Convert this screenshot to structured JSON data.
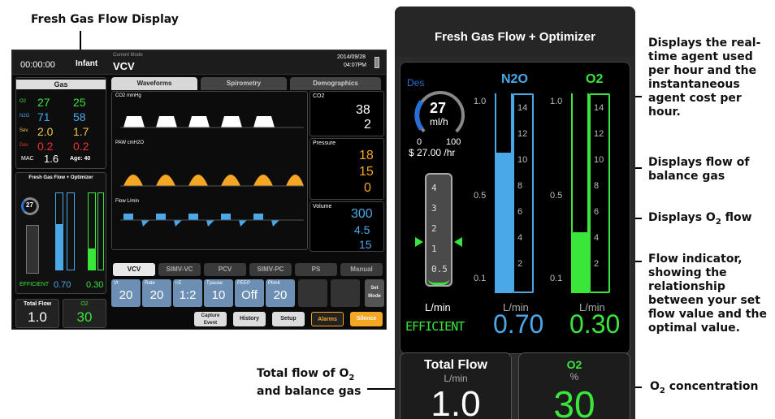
{
  "callouts": {
    "mini_title": "Fresh Gas Flow Display",
    "agent": "Displays the real-time agent used per hour and the instantaneous agent cost per hour.",
    "balance": "Displays flow of balance gas",
    "o2flow_prefix": "Displays O",
    "o2flow_sub": "2",
    "o2flow_suffix": " flow",
    "indicator": "Flow indicator, showing the relationship between your set flow value and the optimal value.",
    "total_prefix": "Total flow of O",
    "total_sub": "2",
    "total_suffix": " and balance gas",
    "conc_prefix": "O",
    "conc_sub": "2",
    "conc_suffix": " concentration"
  },
  "mini": {
    "timer": "00:00:00",
    "patient": "Infant",
    "mode_label": "Current Mode",
    "mode": "VCV",
    "date": "2014/09/28",
    "time": "04:07PM",
    "tabs": [
      "Waveforms",
      "Spirometry",
      "Demographics"
    ],
    "gas_title": "Gas",
    "gas_rows": [
      {
        "name": "O2",
        "insp": "27",
        "exp": "25",
        "color": "#39e639"
      },
      {
        "name": "N2O",
        "insp": "71",
        "exp": "58",
        "color": "#4aa8e8"
      },
      {
        "name": "Sev",
        "insp": "2.0",
        "exp": "1.7",
        "color": "#f2c84b"
      },
      {
        "name": "Des",
        "insp": "0.2",
        "exp": "0.2",
        "color": "#e33"
      }
    ],
    "mac_label": "MAC",
    "mac": "1.6",
    "age": "Age: 40",
    "fgf_title": "Fresh Gas Flow + Optimizer",
    "n2o_value": "0.70",
    "o2_value": "0.30",
    "efficient": "EFFICIENT",
    "total_flow_label": "Total Flow",
    "total_flow": "1.0",
    "o2_pct_label": "O2",
    "o2_pct": "30",
    "wave_labels": [
      "CO2 mmHg",
      "PAW cmH2O",
      "Flow L/min"
    ],
    "co2": {
      "title": "CO2",
      "et": "38",
      "fi": "2"
    },
    "pressure": {
      "title": "Pressure",
      "peak": "18",
      "plat": "15",
      "peep": "0"
    },
    "volume": {
      "title": "Volume",
      "vt": "300",
      "mv": "4.5",
      "rate": "15"
    },
    "mode_tabs": [
      "VCV",
      "SIMV-VC",
      "PCV",
      "SIMV-PC",
      "PS",
      "Manual"
    ],
    "params": [
      {
        "label": "Vt",
        "value": "20"
      },
      {
        "label": "Rate",
        "value": "20"
      },
      {
        "label": "I:E",
        "value": "1:2"
      },
      {
        "label": "Tpause",
        "value": "10"
      },
      {
        "label": "PEEP",
        "value": "Off"
      },
      {
        "label": "Plimit",
        "value": "20"
      }
    ],
    "set_mode": "Set Mode",
    "buttons": [
      "Capture Event",
      "History",
      "Setup",
      "Alarms",
      "Silence"
    ]
  },
  "big": {
    "title": "Fresh Gas Flow + Optimizer",
    "agent_name": "Des",
    "agent_value": "27",
    "agent_unit": "ml/h",
    "gauge_min": "0",
    "gauge_max": "100",
    "cost": "$ 27.00 /hr",
    "indicator_ticks": [
      "4",
      "3",
      "2",
      "1",
      "0.5"
    ],
    "n2o_label": "N2O",
    "o2_label": "O2",
    "n2o_level": 0.7,
    "o2_level": 0.3,
    "tube_ticks": [
      "14",
      "12",
      "10",
      "8",
      "6",
      "4",
      "2"
    ],
    "tube_scale_left": [
      "1.0",
      "0.5",
      "0.1"
    ],
    "unit": "L/min",
    "efficient": "EFFICIENT",
    "n2o_value": "0.70",
    "o2_value": "0.30",
    "total_flow_label": "Total Flow",
    "total_flow_unit": "L/min",
    "total_flow": "1.0",
    "o2_pct_label": "O2",
    "o2_pct_unit": "%",
    "o2_pct": "30"
  },
  "colors": {
    "n2o": "#4aa8e8",
    "o2": "#39e639",
    "des": "#2a6fd6",
    "warn": "#f5a623"
  }
}
